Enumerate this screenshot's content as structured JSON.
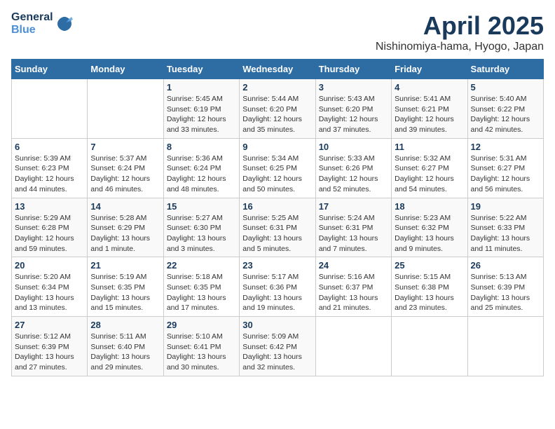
{
  "header": {
    "logo_general": "General",
    "logo_blue": "Blue",
    "title": "April 2025",
    "subtitle": "Nishinomiya-hama, Hyogo, Japan"
  },
  "days_of_week": [
    "Sunday",
    "Monday",
    "Tuesday",
    "Wednesday",
    "Thursday",
    "Friday",
    "Saturday"
  ],
  "weeks": [
    [
      {
        "day": "",
        "sunrise": "",
        "sunset": "",
        "daylight": ""
      },
      {
        "day": "",
        "sunrise": "",
        "sunset": "",
        "daylight": ""
      },
      {
        "day": "1",
        "sunrise": "Sunrise: 5:45 AM",
        "sunset": "Sunset: 6:19 PM",
        "daylight": "Daylight: 12 hours and 33 minutes."
      },
      {
        "day": "2",
        "sunrise": "Sunrise: 5:44 AM",
        "sunset": "Sunset: 6:20 PM",
        "daylight": "Daylight: 12 hours and 35 minutes."
      },
      {
        "day": "3",
        "sunrise": "Sunrise: 5:43 AM",
        "sunset": "Sunset: 6:20 PM",
        "daylight": "Daylight: 12 hours and 37 minutes."
      },
      {
        "day": "4",
        "sunrise": "Sunrise: 5:41 AM",
        "sunset": "Sunset: 6:21 PM",
        "daylight": "Daylight: 12 hours and 39 minutes."
      },
      {
        "day": "5",
        "sunrise": "Sunrise: 5:40 AM",
        "sunset": "Sunset: 6:22 PM",
        "daylight": "Daylight: 12 hours and 42 minutes."
      }
    ],
    [
      {
        "day": "6",
        "sunrise": "Sunrise: 5:39 AM",
        "sunset": "Sunset: 6:23 PM",
        "daylight": "Daylight: 12 hours and 44 minutes."
      },
      {
        "day": "7",
        "sunrise": "Sunrise: 5:37 AM",
        "sunset": "Sunset: 6:24 PM",
        "daylight": "Daylight: 12 hours and 46 minutes."
      },
      {
        "day": "8",
        "sunrise": "Sunrise: 5:36 AM",
        "sunset": "Sunset: 6:24 PM",
        "daylight": "Daylight: 12 hours and 48 minutes."
      },
      {
        "day": "9",
        "sunrise": "Sunrise: 5:34 AM",
        "sunset": "Sunset: 6:25 PM",
        "daylight": "Daylight: 12 hours and 50 minutes."
      },
      {
        "day": "10",
        "sunrise": "Sunrise: 5:33 AM",
        "sunset": "Sunset: 6:26 PM",
        "daylight": "Daylight: 12 hours and 52 minutes."
      },
      {
        "day": "11",
        "sunrise": "Sunrise: 5:32 AM",
        "sunset": "Sunset: 6:27 PM",
        "daylight": "Daylight: 12 hours and 54 minutes."
      },
      {
        "day": "12",
        "sunrise": "Sunrise: 5:31 AM",
        "sunset": "Sunset: 6:27 PM",
        "daylight": "Daylight: 12 hours and 56 minutes."
      }
    ],
    [
      {
        "day": "13",
        "sunrise": "Sunrise: 5:29 AM",
        "sunset": "Sunset: 6:28 PM",
        "daylight": "Daylight: 12 hours and 59 minutes."
      },
      {
        "day": "14",
        "sunrise": "Sunrise: 5:28 AM",
        "sunset": "Sunset: 6:29 PM",
        "daylight": "Daylight: 13 hours and 1 minute."
      },
      {
        "day": "15",
        "sunrise": "Sunrise: 5:27 AM",
        "sunset": "Sunset: 6:30 PM",
        "daylight": "Daylight: 13 hours and 3 minutes."
      },
      {
        "day": "16",
        "sunrise": "Sunrise: 5:25 AM",
        "sunset": "Sunset: 6:31 PM",
        "daylight": "Daylight: 13 hours and 5 minutes."
      },
      {
        "day": "17",
        "sunrise": "Sunrise: 5:24 AM",
        "sunset": "Sunset: 6:31 PM",
        "daylight": "Daylight: 13 hours and 7 minutes."
      },
      {
        "day": "18",
        "sunrise": "Sunrise: 5:23 AM",
        "sunset": "Sunset: 6:32 PM",
        "daylight": "Daylight: 13 hours and 9 minutes."
      },
      {
        "day": "19",
        "sunrise": "Sunrise: 5:22 AM",
        "sunset": "Sunset: 6:33 PM",
        "daylight": "Daylight: 13 hours and 11 minutes."
      }
    ],
    [
      {
        "day": "20",
        "sunrise": "Sunrise: 5:20 AM",
        "sunset": "Sunset: 6:34 PM",
        "daylight": "Daylight: 13 hours and 13 minutes."
      },
      {
        "day": "21",
        "sunrise": "Sunrise: 5:19 AM",
        "sunset": "Sunset: 6:35 PM",
        "daylight": "Daylight: 13 hours and 15 minutes."
      },
      {
        "day": "22",
        "sunrise": "Sunrise: 5:18 AM",
        "sunset": "Sunset: 6:35 PM",
        "daylight": "Daylight: 13 hours and 17 minutes."
      },
      {
        "day": "23",
        "sunrise": "Sunrise: 5:17 AM",
        "sunset": "Sunset: 6:36 PM",
        "daylight": "Daylight: 13 hours and 19 minutes."
      },
      {
        "day": "24",
        "sunrise": "Sunrise: 5:16 AM",
        "sunset": "Sunset: 6:37 PM",
        "daylight": "Daylight: 13 hours and 21 minutes."
      },
      {
        "day": "25",
        "sunrise": "Sunrise: 5:15 AM",
        "sunset": "Sunset: 6:38 PM",
        "daylight": "Daylight: 13 hours and 23 minutes."
      },
      {
        "day": "26",
        "sunrise": "Sunrise: 5:13 AM",
        "sunset": "Sunset: 6:39 PM",
        "daylight": "Daylight: 13 hours and 25 minutes."
      }
    ],
    [
      {
        "day": "27",
        "sunrise": "Sunrise: 5:12 AM",
        "sunset": "Sunset: 6:39 PM",
        "daylight": "Daylight: 13 hours and 27 minutes."
      },
      {
        "day": "28",
        "sunrise": "Sunrise: 5:11 AM",
        "sunset": "Sunset: 6:40 PM",
        "daylight": "Daylight: 13 hours and 29 minutes."
      },
      {
        "day": "29",
        "sunrise": "Sunrise: 5:10 AM",
        "sunset": "Sunset: 6:41 PM",
        "daylight": "Daylight: 13 hours and 30 minutes."
      },
      {
        "day": "30",
        "sunrise": "Sunrise: 5:09 AM",
        "sunset": "Sunset: 6:42 PM",
        "daylight": "Daylight: 13 hours and 32 minutes."
      },
      {
        "day": "",
        "sunrise": "",
        "sunset": "",
        "daylight": ""
      },
      {
        "day": "",
        "sunrise": "",
        "sunset": "",
        "daylight": ""
      },
      {
        "day": "",
        "sunrise": "",
        "sunset": "",
        "daylight": ""
      }
    ]
  ]
}
